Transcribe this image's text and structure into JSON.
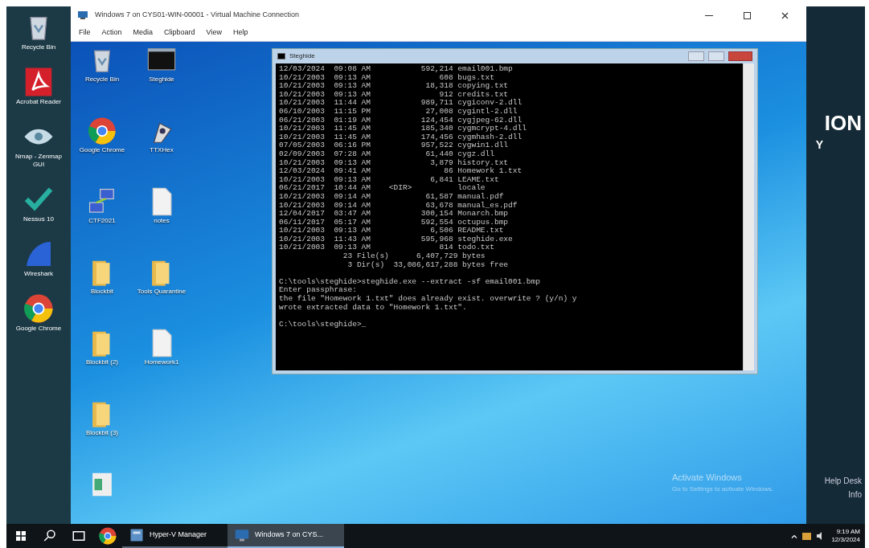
{
  "host_desktop": {
    "icons": [
      {
        "label": "Recycle Bin",
        "kind": "recycle"
      },
      {
        "label": "Acrobat Reader",
        "kind": "pdf"
      },
      {
        "label": "Nmap - Zenmap GUI",
        "kind": "eye"
      },
      {
        "label": "Nessus 10",
        "kind": "check"
      },
      {
        "label": "Wireshark",
        "kind": "fin"
      },
      {
        "label": "Google Chrome",
        "kind": "chrome"
      }
    ],
    "wallpaper_texts": [
      "ION",
      "Y"
    ],
    "side_texts": [
      "Help Desk",
      "Info"
    ],
    "activation": {
      "title": "Activate Windows",
      "subtitle": "Go to Settings to activate Windows."
    }
  },
  "vm_window": {
    "title": "Windows 7 on CYS01-WIN-00001 - Virtual Machine Connection",
    "menu": [
      "File",
      "Action",
      "Media",
      "Clipboard",
      "View",
      "Help"
    ],
    "guest_icons": [
      {
        "label": "Recycle Bin",
        "kind": "recycle"
      },
      {
        "label": "Steghide",
        "kind": "console"
      },
      {
        "label": "Google Chrome",
        "kind": "chrome"
      },
      {
        "label": "TTXHex",
        "kind": "tool"
      },
      {
        "label": "CTF2021",
        "kind": "network"
      },
      {
        "label": "notes",
        "kind": "file"
      },
      {
        "label": "Blockbit",
        "kind": "folder"
      },
      {
        "label": "Tools Quarantine",
        "kind": "folder"
      },
      {
        "label": "Blockbit (2)",
        "kind": "folder"
      },
      {
        "label": "Homework1",
        "kind": "file"
      },
      {
        "label": "Blockbit (3)",
        "kind": "folder"
      },
      {
        "kind": "image"
      }
    ],
    "console": {
      "title": "Steghide",
      "blocks": [
        [
          "12/03/2024  09:08 AM           592,214 email001.bmp",
          "10/21/2003  09:13 AM               608 bugs.txt",
          "10/21/2003  09:13 AM            18,318 copying.txt",
          "10/21/2003  09:13 AM               912 credits.txt",
          "10/21/2003  11:44 AM           989,711 cygiconv-2.dll",
          "06/10/2003  11:15 PM            27,008 cygintl-2.dll",
          "06/21/2003  01:19 AM           124,454 cygjpeg-62.dll",
          "10/21/2003  11:45 AM           185,340 cygmcrypt-4.dll",
          "10/21/2003  11:45 AM           174,456 cygmhash-2.dll",
          "07/05/2003  06:16 PM           957,522 cygwin1.dll",
          "02/09/2003  07:28 AM            61,440 cygz.dll",
          "10/21/2003  09:13 AM             3,879 history.txt",
          "12/03/2024  09:41 AM                86 Homework 1.txt",
          "10/21/2003  09:13 AM             6,841 LEAME.txt",
          "06/21/2017  10:44 AM    <DIR>          locale",
          "10/21/2003  09:14 AM            61,587 manual.pdf",
          "10/21/2003  09:14 AM            63,678 manual_es.pdf",
          "12/04/2017  03:47 AM           300,154 Monarch.bmp",
          "06/11/2017  05:17 AM           592,554 octupus.bmp",
          "10/21/2003  09:13 AM             6,506 README.txt",
          "10/21/2003  11:43 AM           595,968 steghide.exe",
          "10/21/2003  09:13 AM               814 todo.txt",
          "              23 File(s)      6,407,729 bytes",
          "               3 Dir(s)  33,086,617,288 bytes free"
        ],
        [
          "C:\\tools\\steghide>steghide.exe --extract -sf email001.bmp",
          "Enter passphrase:",
          "the file \"Homework 1.txt\" does already exist. overwrite ? (y/n) y",
          "wrote extracted data to \"Homework 1.txt\"."
        ],
        [
          "C:\\tools\\steghide>_"
        ]
      ]
    }
  },
  "taskbar": {
    "apps": [
      {
        "kind": "start",
        "selected": false
      },
      {
        "kind": "search",
        "selected": false
      },
      {
        "kind": "taskview",
        "selected": false
      },
      {
        "kind": "chrome",
        "selected": false
      },
      {
        "label": "Hyper-V Manager",
        "kind": "hyperv",
        "selected": false
      },
      {
        "label": "Windows 7 on CYS...",
        "kind": "vm",
        "selected": true
      }
    ],
    "time": "9:19 AM",
    "date": "12/3/2024"
  }
}
